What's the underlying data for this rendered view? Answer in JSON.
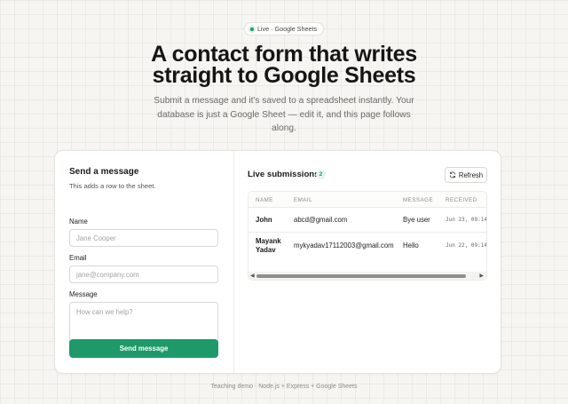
{
  "badge": {
    "icon": "live-dot-icon",
    "label": "Live · Google Sheets"
  },
  "hero": {
    "title_line1": "A contact form that writes",
    "title_line2": "straight to Google Sheets",
    "subtitle": "Submit a message and it's saved to a spreadsheet instantly. Your database is just a Google Sheet — edit it, and this page follows along."
  },
  "form": {
    "title": "Send a message",
    "subtitle": "This adds a row to the sheet.",
    "name_label": "Name",
    "name_placeholder": "Jane Cooper",
    "name_value": "",
    "email_label": "Email",
    "email_placeholder": "jane@company.com",
    "email_value": "",
    "message_label": "Message",
    "message_placeholder": "How can we help?",
    "message_value": "",
    "submit_label": "Send message"
  },
  "submissions": {
    "title": "Live submissions",
    "count": "2",
    "refresh_label": "Refresh",
    "refresh_icon": "refresh-icon",
    "columns": [
      "NAME",
      "EMAIL",
      "MESSAGE",
      "RECEIVED"
    ],
    "rows": [
      {
        "name": "John",
        "email": "abcd@gmail.com",
        "message": "Bye user",
        "received": "Jun 23, 09:14"
      },
      {
        "name": "Mayank Yadav",
        "email": "mykyadav17112003@gmail.com",
        "message": "Hello",
        "received": "Jun 22, 09:14"
      }
    ]
  },
  "footer": {
    "text": "Teaching demo · Node.js + Express + Google Sheets"
  },
  "colors": {
    "accent": "#1e9a6a",
    "background": "#f6f5f1"
  }
}
